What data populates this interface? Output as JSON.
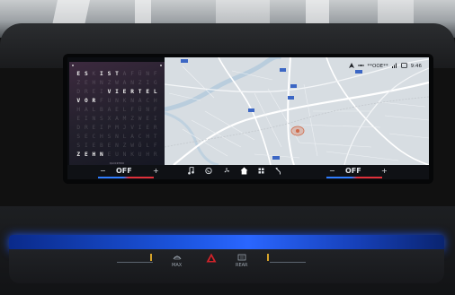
{
  "status_bar": {
    "time": "9:46",
    "center_text": "**OOE**",
    "phone_icon": "phone-icon",
    "signal_icon": "signal-icon",
    "connect_icon": "connectivity-icon",
    "nav_icon": "navigation-arrow-icon"
  },
  "word_clock": {
    "rows": [
      "ESKISTAFÜNF",
      "ZEHNZWANZIG",
      "DREIVIERTEL",
      "VORFUNKNACH",
      "HALBAELFÜNF",
      "EINSXAMZWEI",
      "DREIPMJVIER",
      "SECHSNLACHT",
      "SIEBENZWÖLF",
      "ZEHNEUNKUHR"
    ],
    "active": [
      [
        0,
        0
      ],
      [
        0,
        1
      ],
      [
        0,
        3
      ],
      [
        0,
        4
      ],
      [
        0,
        5
      ],
      [
        2,
        4
      ],
      [
        2,
        5
      ],
      [
        2,
        6
      ],
      [
        2,
        7
      ],
      [
        2,
        8
      ],
      [
        2,
        9
      ],
      [
        2,
        10
      ],
      [
        3,
        0
      ],
      [
        3,
        1
      ],
      [
        3,
        2
      ],
      [
        9,
        0
      ],
      [
        9,
        1
      ],
      [
        9,
        2
      ],
      [
        9,
        3
      ]
    ],
    "caption": "QLOCKTWO"
  },
  "map": {
    "road_labels": [
      "150",
      "13",
      "152",
      "140",
      "13",
      "152",
      "130",
      "A1"
    ]
  },
  "bottom_bar": {
    "left_minus": "−",
    "left_temp": "OFF",
    "left_plus": "+",
    "media_icon": "music-note-icon",
    "phone_icon": "phone-icon",
    "fan_icon": "fan-icon",
    "home_icon": "home-icon",
    "apps_icon": "apps-grid-icon",
    "back_icon": "back-arrow-icon",
    "right_minus": "−",
    "right_temp": "OFF",
    "right_plus": "+"
  },
  "console": {
    "max_label": "MAX",
    "rear_label": "REAR",
    "hazard_icon": "hazard-triangle-icon"
  }
}
